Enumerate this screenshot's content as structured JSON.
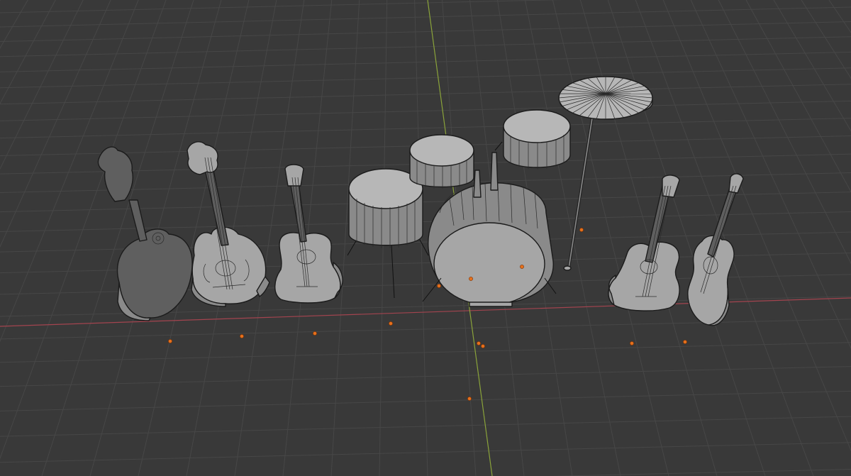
{
  "viewport": {
    "editor": "3D Viewport",
    "background_color": "#393939",
    "grid_color": "#474747",
    "x_axis_color": "#a3444f",
    "y_axis_color": "#8aa33a",
    "origin_color": "#e5701c"
  },
  "objects": [
    {
      "name": "mandolin-f-style",
      "type": "mesh"
    },
    {
      "name": "mandolin-f-style-2",
      "type": "mesh"
    },
    {
      "name": "acoustic-guitar-small",
      "type": "mesh"
    },
    {
      "name": "floor-tom",
      "type": "mesh"
    },
    {
      "name": "rack-tom-1",
      "type": "mesh"
    },
    {
      "name": "rack-tom-2",
      "type": "mesh"
    },
    {
      "name": "bass-drum",
      "type": "mesh"
    },
    {
      "name": "cymbal",
      "type": "mesh"
    },
    {
      "name": "acoustic-guitar",
      "type": "mesh"
    },
    {
      "name": "acoustic-guitar-tilted",
      "type": "mesh"
    }
  ]
}
